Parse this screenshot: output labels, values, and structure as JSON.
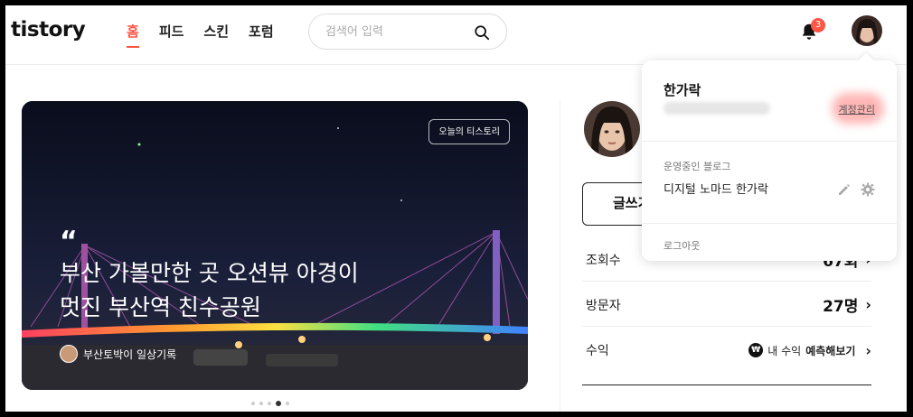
{
  "header": {
    "logo": "tistory",
    "nav": [
      "홈",
      "피드",
      "스킨",
      "포럼"
    ],
    "search_placeholder": "검색어 입력",
    "notification_count": "3"
  },
  "hero": {
    "tag": "오늘의 티스토리",
    "quote": "“",
    "title": "부산 가볼만한 곳 오션뷰 아경이 멋진 부산역 친수공원",
    "author": "부산토박이 일상기록",
    "page_index": 4,
    "page_count": 5
  },
  "sidebar": {
    "write_label": "글쓰기",
    "stats": [
      {
        "label": "조회수",
        "value": "67회"
      },
      {
        "label": "방문자",
        "value": "27명"
      },
      {
        "label": "수익",
        "value_prefix": "내 수익",
        "value_link": "예측해보기"
      }
    ]
  },
  "dropdown": {
    "name": "한가락",
    "manage": "계정관리",
    "section": "운영중인 블로그",
    "blog": "디지털 노마드 한가락",
    "logout": "로그아웃"
  },
  "colors": {
    "accent": "#ff5544"
  }
}
